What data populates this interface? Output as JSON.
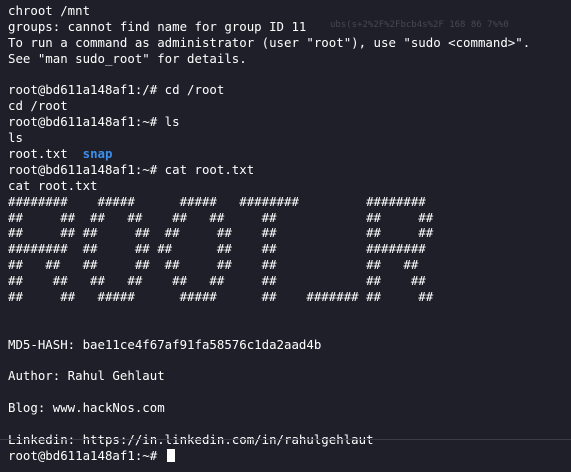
{
  "terminal": {
    "lines_top": [
      "chroot /mnt",
      "groups: cannot find name for group ID 11",
      "To run a command as administrator (user \"root\"), use \"sudo <command>\".",
      "See \"man sudo_root\" for details.",
      "",
      "root@bd611a148af1:/# cd /root",
      "cd /root",
      "root@bd611a148af1:~# ls",
      "ls"
    ],
    "ls_output": {
      "file": "root.txt",
      "separator": "  ",
      "dir": "snap"
    },
    "lines_mid": [
      "root@bd611a148af1:~# cat root.txt",
      "cat root.txt"
    ],
    "banner": [
      "########    #####      #####   ########         ########",
      "##     ##  ##   ##    ##   ##     ##            ##     ##",
      "##     ## ##     ##  ##     ##    ##            ##     ##",
      "########  ##     ## ##      ##    ##            ########",
      "##   ##   ##     ##  ##     ##    ##            ##   ##",
      "##    ##   ##   ##    ##   ##     ##            ##    ##",
      "##     ##   #####      #####      ##    ####### ##     ##"
    ],
    "lines_bottom": [
      "",
      "",
      "MD5-HASH: bae11ce4f67af91fa58576c1da2aad4b",
      "",
      "Author: Rahul Gehlaut",
      "",
      "Blog: www.hackNos.com",
      "",
      "Linkedin: https://in.linkedin.com/in/rahulgehlaut"
    ],
    "final_prompt": "root@bd611a148af1:~# ",
    "ghost_text": "ubs(s+2%2F%2Fbcb4s%2F 168 86 7%%0"
  },
  "colors": {
    "background": "#1e1f29",
    "foreground": "#ffffff",
    "directory": "#3b8eea"
  }
}
